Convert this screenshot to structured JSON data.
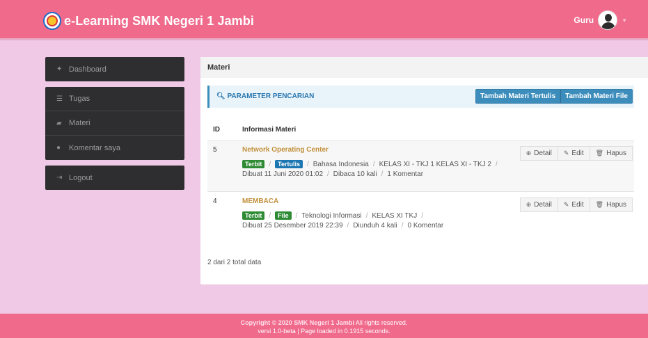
{
  "header": {
    "app_title": "e-Learning SMK Negeri 1 Jambi",
    "user_label": "Guru"
  },
  "sidebar": {
    "groups": [
      [
        {
          "label": "Dashboard",
          "icon": "home-icon"
        }
      ],
      [
        {
          "label": "Tugas",
          "icon": "list-icon"
        },
        {
          "label": "Materi",
          "icon": "book-icon"
        },
        {
          "label": "Komentar saya",
          "icon": "comments-icon"
        }
      ],
      [
        {
          "label": "Logout",
          "icon": "sign-out-icon"
        }
      ]
    ]
  },
  "main": {
    "title": "Materi",
    "search_label": "PARAMETER PENCARIAN",
    "buttons": {
      "add_text": "Tambah Materi Tertulis",
      "add_file": "Tambah Materi File"
    },
    "columns": {
      "id": "ID",
      "info": "Informasi Materi"
    },
    "actions": {
      "detail": "Detail",
      "edit": "Edit",
      "delete": "Hapus"
    },
    "rows": [
      {
        "id": "5",
        "title": "Network Operating Center",
        "status": "Terbit",
        "type": "Tertulis",
        "subject": "Bahasa Indonesia",
        "classes": "KELAS XI - TKJ 1  KELAS XI - TKJ 2",
        "created": "Dibuat 11 Juni 2020 01:02",
        "views": "Dibaca 10 kali",
        "comments": "1 Komentar"
      },
      {
        "id": "4",
        "title": "MEMBACA",
        "status": "Terbit",
        "type": "File",
        "subject": "Teknologi Informasi",
        "classes": "KELAS XI TKJ",
        "created": "Dibuat 25 Desember 2019 22:39",
        "views": "Diunduh 4 kali",
        "comments": "0 Komentar"
      }
    ],
    "total_text": "2 dari 2 total data"
  },
  "footer": {
    "copyright_prefix": "Copyright © 2020",
    "school": "SMK Negeri 1 Jambi",
    "rights": "All rights reserved.",
    "version": "versi 1.0-beta | Page loaded in 0.1915 seconds."
  },
  "colors": {
    "topbar": "#f06a8c",
    "sidebar": "#2e2e30",
    "accent": "#3c8dbc",
    "title_link": "#c2913c",
    "badge_green": "#2e8b34",
    "badge_blue": "#1b76b1"
  }
}
